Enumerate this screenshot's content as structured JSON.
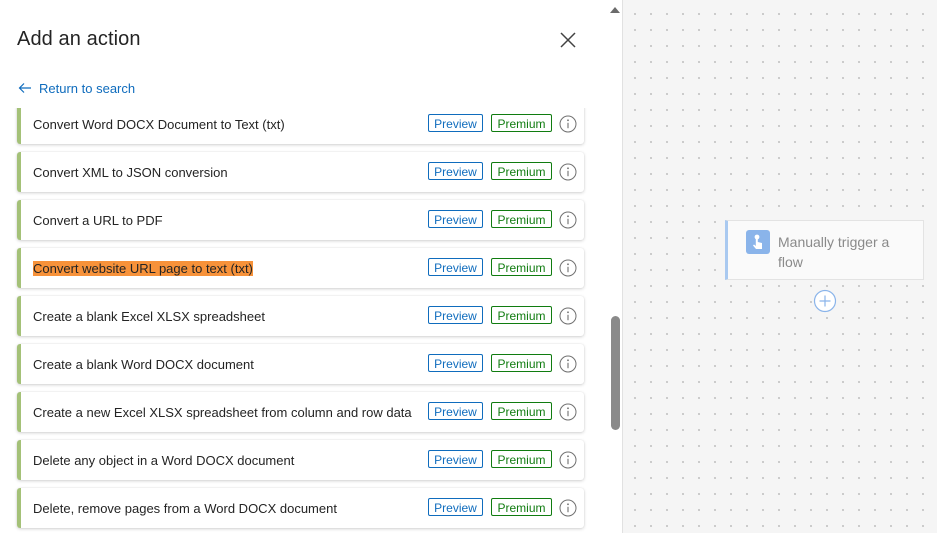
{
  "panel": {
    "title": "Add an action",
    "close_icon": "close-icon",
    "return_link": "Return to search"
  },
  "actions": [
    {
      "label": "Convert Word DOCX Document to Text (txt)",
      "preview": "Preview",
      "premium": "Premium",
      "highlighted": false
    },
    {
      "label": "Convert XML to JSON conversion",
      "preview": "Preview",
      "premium": "Premium",
      "highlighted": false
    },
    {
      "label": "Convert a URL to PDF",
      "preview": "Preview",
      "premium": "Premium",
      "highlighted": false
    },
    {
      "label": "Convert website URL page to text (txt)",
      "preview": "Preview",
      "premium": "Premium",
      "highlighted": true
    },
    {
      "label": "Create a blank Excel XLSX spreadsheet",
      "preview": "Preview",
      "premium": "Premium",
      "highlighted": false
    },
    {
      "label": "Create a blank Word DOCX document",
      "preview": "Preview",
      "premium": "Premium",
      "highlighted": false
    },
    {
      "label": "Create a new Excel XLSX spreadsheet from column and row data",
      "preview": "Preview",
      "premium": "Premium",
      "highlighted": false
    },
    {
      "label": "Delete any object in a Word DOCX document",
      "preview": "Preview",
      "premium": "Premium",
      "highlighted": false
    },
    {
      "label": "Delete, remove pages from a Word DOCX document",
      "preview": "Preview",
      "premium": "Premium",
      "highlighted": false
    }
  ],
  "canvas": {
    "trigger_label": "Manually trigger a flow",
    "trigger_icon": "hand-touch-icon",
    "add_icon": "plus-circle-icon"
  },
  "colors": {
    "accent_bar": "#a4c178",
    "highlight": "#f7923a",
    "preview_blue": "#0f6cbd",
    "premium_green": "#107c10",
    "trigger_blue": "#8ab4ea"
  }
}
